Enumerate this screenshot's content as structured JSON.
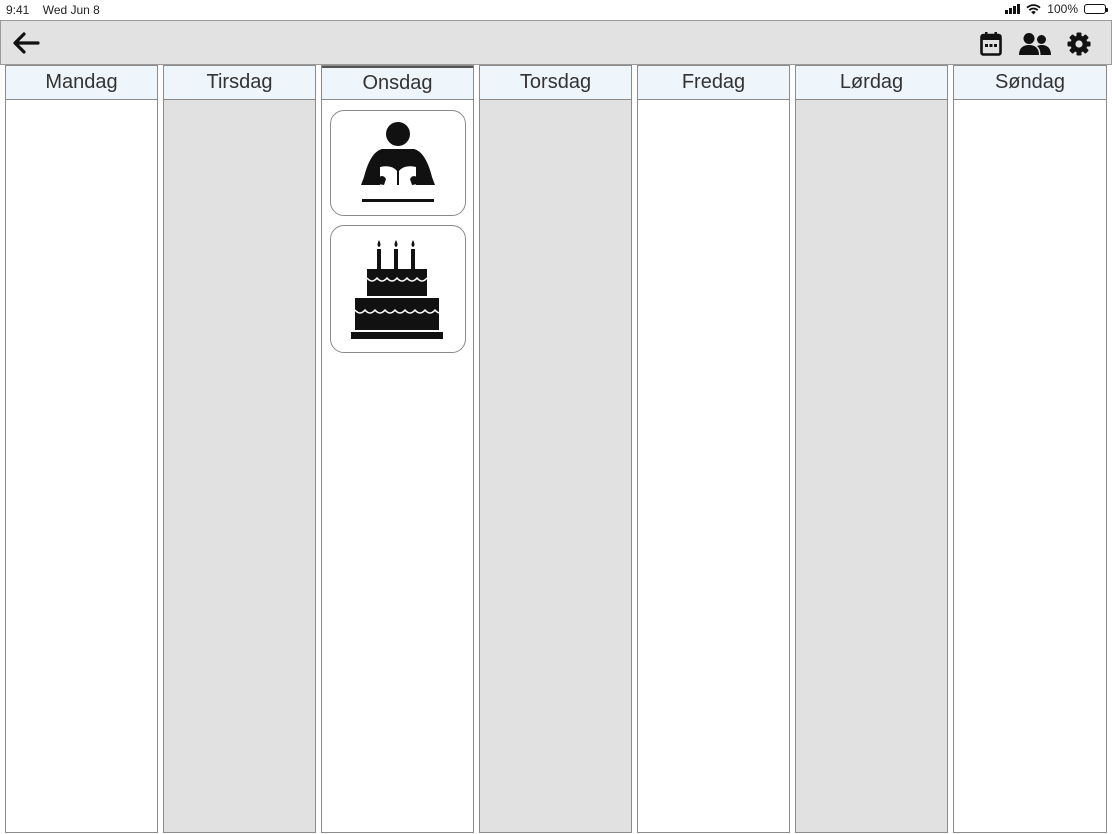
{
  "status_bar": {
    "time": "9:41",
    "date": "Wed Jun 8",
    "battery": "100%"
  },
  "toolbar": {
    "back_icon": "arrow-left-icon",
    "tools": [
      "calendar-icon",
      "people-icon",
      "gear-icon"
    ]
  },
  "week": {
    "days": [
      {
        "label": "Mandag",
        "shaded": false
      },
      {
        "label": "Tirsdag",
        "shaded": true
      },
      {
        "label": "Onsdag",
        "shaded": false,
        "today": true
      },
      {
        "label": "Torsdag",
        "shaded": true
      },
      {
        "label": "Fredag",
        "shaded": false
      },
      {
        "label": "Lørdag",
        "shaded": true
      },
      {
        "label": "Søndag",
        "shaded": false
      }
    ],
    "activities": [
      {
        "day": "Onsdag",
        "icon": "reading-person-icon"
      },
      {
        "day": "Onsdag",
        "icon": "birthday-cake-icon"
      }
    ]
  },
  "colors": {
    "toolbar_bg": "#e2e2e2",
    "header_bg": "#eef5fb",
    "shaded_bg": "#e1e1e1",
    "icon": "#111111"
  }
}
